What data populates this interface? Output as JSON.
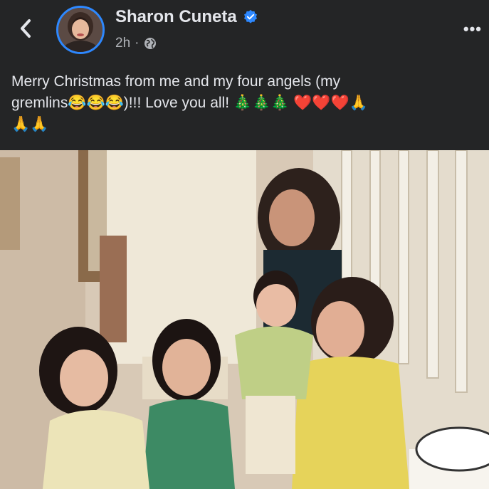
{
  "post": {
    "author": "Sharon Cuneta",
    "time": "2h",
    "privacy_separator": "·",
    "caption_line1": "Merry Christmas from me and my four angels (my",
    "caption_line2": "gremlins😂😂😂)!!! Love you all! 🎄🎄🎄 ❤️❤️❤️🙏",
    "caption_line3": "🙏🙏"
  },
  "icons": {
    "back": "chevron-left-icon",
    "verified": "verified-badge-icon",
    "privacy": "globe-icon",
    "more": "more-options-icon"
  },
  "colors": {
    "background": "#242526",
    "verified": "#2d88ff",
    "text": "#e4e6eb",
    "meta": "#b0b3b8"
  },
  "more_label": "•••"
}
